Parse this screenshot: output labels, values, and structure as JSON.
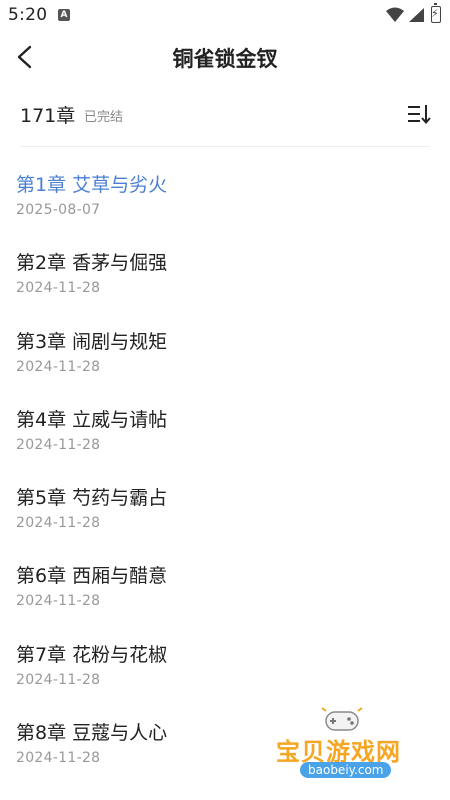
{
  "status_bar": {
    "time": "5:20",
    "app_icon_letter": "A"
  },
  "header": {
    "title": "铜雀锁金钗"
  },
  "summary": {
    "chapter_count": "171章",
    "status": "已完结"
  },
  "chapters": [
    {
      "title": "第1章 艾草与劣火",
      "date": "2025-08-07",
      "active": true
    },
    {
      "title": "第2章 香茅与倔强",
      "date": "2024-11-28"
    },
    {
      "title": "第3章 闹剧与规矩",
      "date": "2024-11-28"
    },
    {
      "title": "第4章 立威与请帖",
      "date": "2024-11-28"
    },
    {
      "title": "第5章 芍药与霸占",
      "date": "2024-11-28"
    },
    {
      "title": "第6章 西厢与醋意",
      "date": "2024-11-28"
    },
    {
      "title": "第7章 花粉与花椒",
      "date": "2024-11-28"
    },
    {
      "title": "第8章 豆蔻与人心",
      "date": "2024-11-28"
    }
  ],
  "watermark": {
    "text": "宝贝游戏网",
    "url": "baobeiy.com"
  },
  "colors": {
    "active": "#4a7fd1",
    "date": "#999999",
    "watermark": "#f5a623"
  }
}
